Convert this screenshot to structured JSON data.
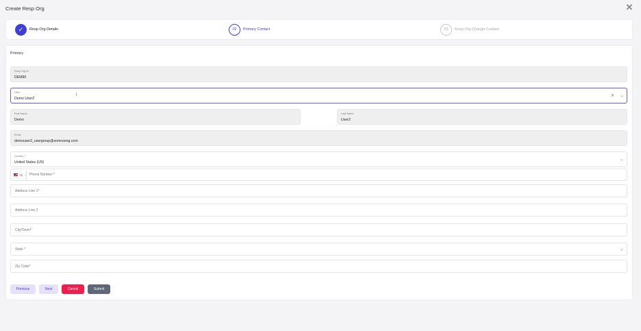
{
  "dialog": {
    "title": "Create Resp Org",
    "close_glyph": "✕"
  },
  "steps": [
    {
      "number": "✓",
      "label": "Resp Org Details",
      "state": "done"
    },
    {
      "number": "02",
      "label": "Primary Contact",
      "state": "active"
    },
    {
      "number": "03",
      "label": "Resp Org Change Contact",
      "state": "todo"
    }
  ],
  "form": {
    "section_title": "Primary",
    "resp_org_id": {
      "label": "Resp Org ID",
      "value": "DEM90"
    },
    "user": {
      "label": "User",
      "value": "Demo User2"
    },
    "first_name": {
      "label": "First Name",
      "value": "Demo"
    },
    "last_name": {
      "label": "Last Name",
      "value": "User2"
    },
    "email": {
      "label": "Email",
      "value": "demouser2_usergroup@somoseng.com"
    },
    "country": {
      "label": "Country",
      "value": "United States (US)"
    },
    "phone": {
      "dial_code": "+1",
      "placeholder": "Phone Number"
    },
    "address1": {
      "placeholder": "Address Line 1"
    },
    "address2": {
      "placeholder": "Address Line 2"
    },
    "city": {
      "placeholder": "City/Town"
    },
    "state": {
      "placeholder": "State"
    },
    "zip": {
      "placeholder": "Zip Code"
    },
    "required_mark": "*"
  },
  "buttons": {
    "previous": "Previous",
    "next": "Next",
    "cancel": "Cancel",
    "submit": "Submit"
  },
  "icons": {
    "chevron": "chevron-down-icon",
    "clear": "clear-icon",
    "close": "close-icon",
    "check": "check-icon"
  },
  "colors": {
    "accent": "#3f3fd1",
    "focus_border": "#6a5bd6",
    "cancel": "#ee1f4f",
    "submit": "#5d6778",
    "secondary_btn_bg": "#e6e0fa",
    "required": "#e0344d"
  }
}
